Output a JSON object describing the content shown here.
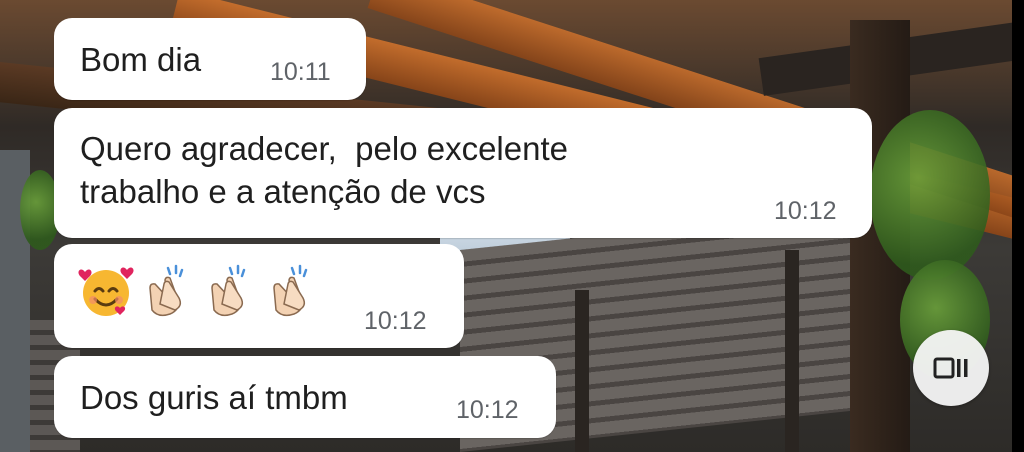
{
  "messages": [
    {
      "text": "Bom dia",
      "time": "10:11"
    },
    {
      "text": "Quero agradecer,  pelo excelente\ntrabalho e a atenção de vcs",
      "time": "10:12"
    },
    {
      "emojis": [
        "smiling-face-with-hearts-icon",
        "clapping-hands-icon",
        "clapping-hands-icon",
        "clapping-hands-icon"
      ],
      "time": "10:12"
    },
    {
      "text": "Dos guris aí tmbm",
      "time": "10:12"
    }
  ],
  "fab": {
    "icon": "pip-toggle-icon"
  },
  "colors": {
    "bubble": "#ffffff",
    "text": "#1f1f1f",
    "time": "#5f6368",
    "emoji_yellow": "#f7b731",
    "heart": "#e0245e",
    "skin": "#f3d2b3"
  }
}
